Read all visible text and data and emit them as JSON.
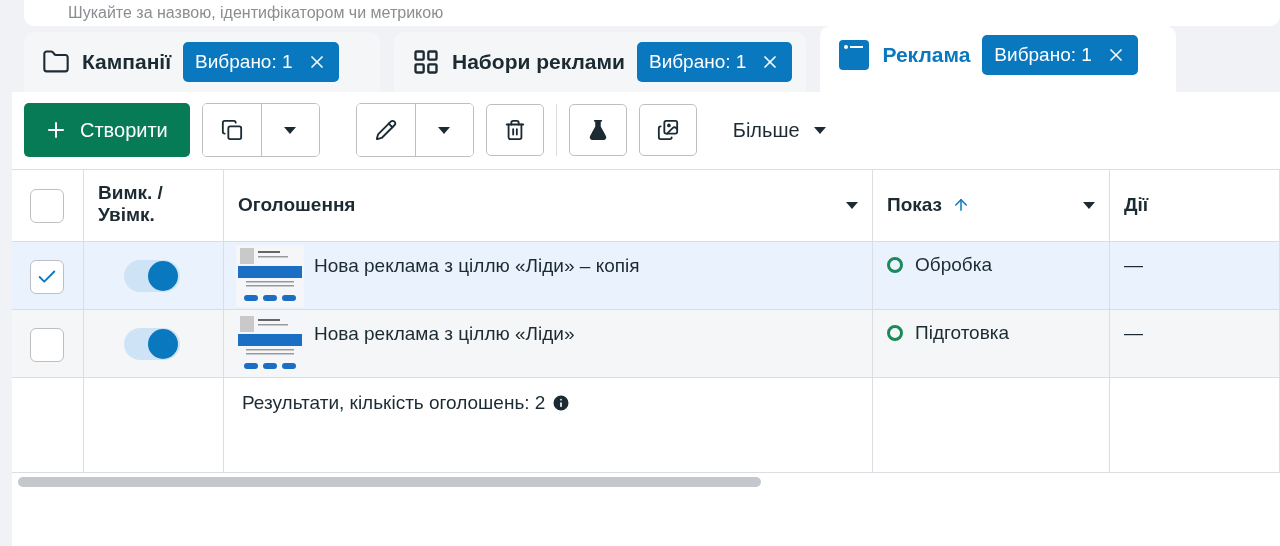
{
  "search": {
    "placeholder": "Шукайте за назвою, ідентифікатором чи метрикою"
  },
  "tabs": [
    {
      "kind": "campaigns",
      "label": "Кампанії",
      "badge": "Вибрано: 1",
      "selected": false
    },
    {
      "kind": "adsets",
      "label": "Набори реклами",
      "badge": "Вибрано: 1",
      "selected": false
    },
    {
      "kind": "ads",
      "label": "Реклама",
      "badge": "Вибрано: 1",
      "selected": true
    }
  ],
  "toolbar": {
    "create": "Створити",
    "more": "Більше"
  },
  "table": {
    "select_all": {
      "checked": false
    },
    "columns": [
      {
        "label": "Вимк. / Увімк.",
        "menu": false,
        "sorted": false
      },
      {
        "label": "Оголошення",
        "menu": true,
        "sorted": false
      },
      {
        "label": "Показ",
        "menu": true,
        "sorted": true
      },
      {
        "label": "Дії",
        "menu": false,
        "sorted": false
      }
    ],
    "rows": [
      {
        "selected": true,
        "on": true,
        "name": "Нова реклама з ціллю «Ліди» – копія",
        "status": "Обробка",
        "color": "#1a8a5a",
        "actions": "—"
      },
      {
        "selected": false,
        "on": true,
        "name": "Нова реклама з ціллю «Ліди»",
        "status": "Підготовка",
        "color": "#1a8a5a",
        "actions": "—"
      }
    ],
    "footer": "Результати, кількість оголошень: 2"
  }
}
